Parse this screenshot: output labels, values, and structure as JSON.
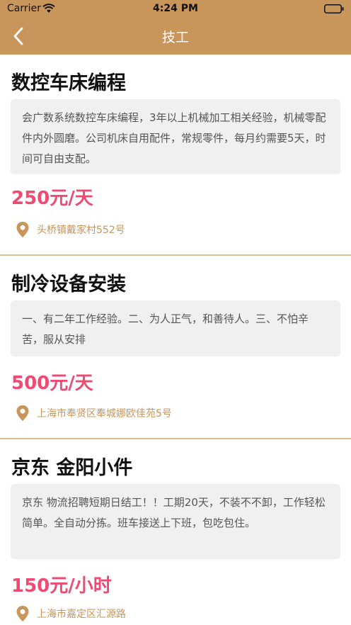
{
  "status_bar": {
    "carrier": "Carrier",
    "time": "4:24 PM"
  },
  "nav": {
    "title": "技工",
    "back_icon": "chevron-left-icon"
  },
  "colors": {
    "brand": "#c8955a",
    "salary": "#ef4a73",
    "divider": "#dcc091"
  },
  "jobs": [
    {
      "title": "数控车床编程",
      "description": "会广数系统数控车床编程，3年以上机械加工相关经验，机械零配件内外圆磨。公司机床自用配件，常规零件，每月约需要5天，时间可自由支配。",
      "salary": "250元/天",
      "address": "头桥镇戴家村552号"
    },
    {
      "title": "制冷设备安装",
      "description": "一、有二年工作经验。二、为人正气，和善待人。三、不怕辛苦，服从安排",
      "salary": "500元/天",
      "address": "上海市奉贤区奉城娜欧佳苑5号"
    },
    {
      "title": "京东 金阳小件",
      "description": "京东 物流招聘短期日结工！！工期20天，不装不不卸，工作轻松简单。全自动分拣。班车接送上下班，包吃包住。",
      "salary": "150元/小时",
      "address": "上海市嘉定区汇源路"
    }
  ]
}
